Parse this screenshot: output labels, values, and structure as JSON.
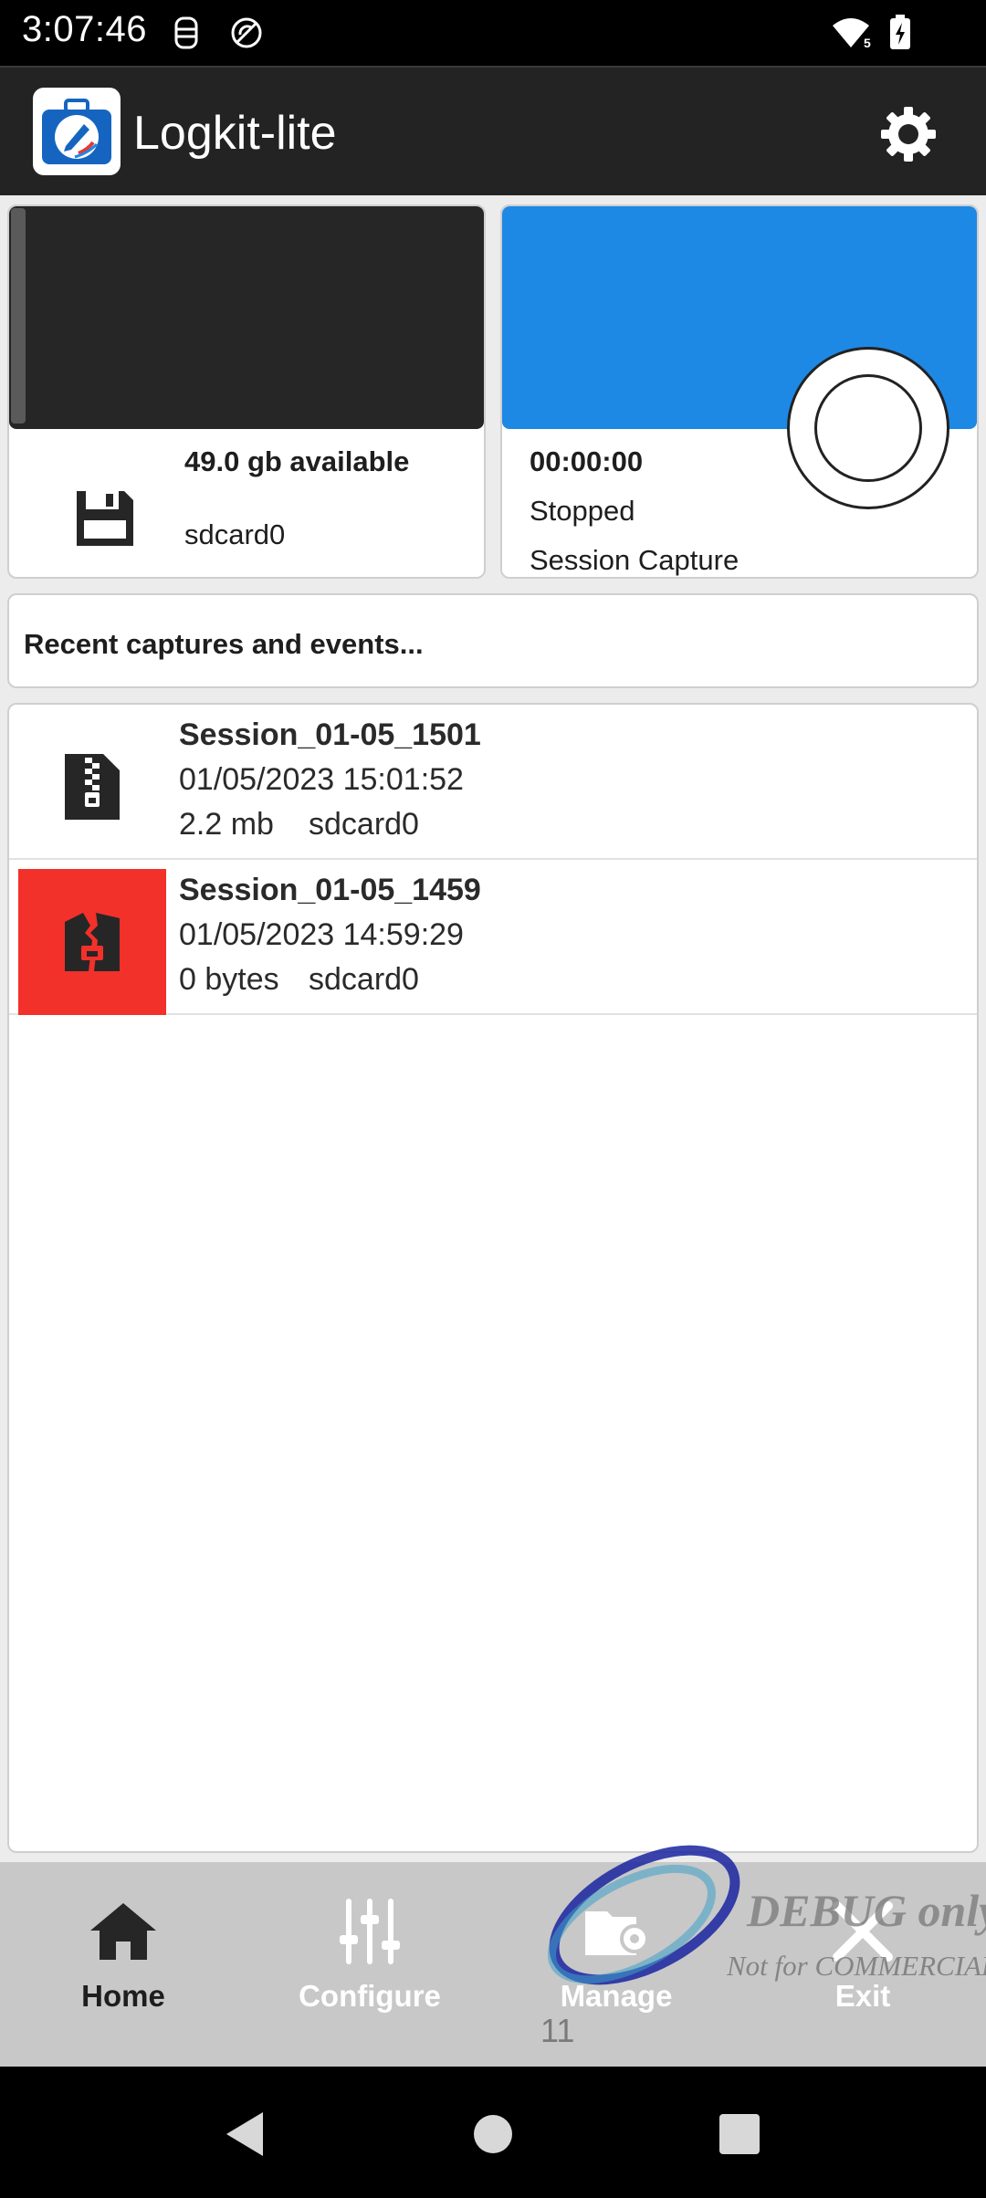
{
  "status_bar": {
    "time": "3:07:46",
    "notification_icons": [
      "device-icon",
      "no-sync-icon"
    ],
    "wifi_badge": "5",
    "battery_state": "charging"
  },
  "app_bar": {
    "title": "Logkit-lite",
    "settings_icon": "gear-icon"
  },
  "storage": {
    "available": "49.0 gb available",
    "device": "sdcard0",
    "icon": "floppy-disk-icon"
  },
  "capture": {
    "elapsed": "00:00:00",
    "status": "Stopped",
    "label": "Session Capture",
    "accent_color": "#1e88e5"
  },
  "recent": {
    "header": "Recent captures and events...",
    "items": [
      {
        "name": "Session_01-05_1501",
        "date": "01/05/2023 15:01:52",
        "size": "2.2 mb",
        "device": "sdcard0",
        "icon": "zip-file-icon"
      },
      {
        "name": "Session_01-05_1459",
        "date": "01/05/2023 14:59:29",
        "size": "0 bytes",
        "device": "sdcard0",
        "icon": "broken-zip-file-icon",
        "error_color": "#f2312a"
      }
    ]
  },
  "bottom_nav": {
    "items": [
      {
        "label": "Home",
        "icon": "home-icon"
      },
      {
        "label": "Configure",
        "icon": "sliders-icon"
      },
      {
        "label": "Manage",
        "icon": "folder-gear-icon"
      },
      {
        "label": "Exit",
        "icon": "close-icon"
      }
    ],
    "page_indicator": "11"
  },
  "watermark": {
    "line1": "DEBUG only",
    "line2": "Not for COMMERCIAL"
  }
}
